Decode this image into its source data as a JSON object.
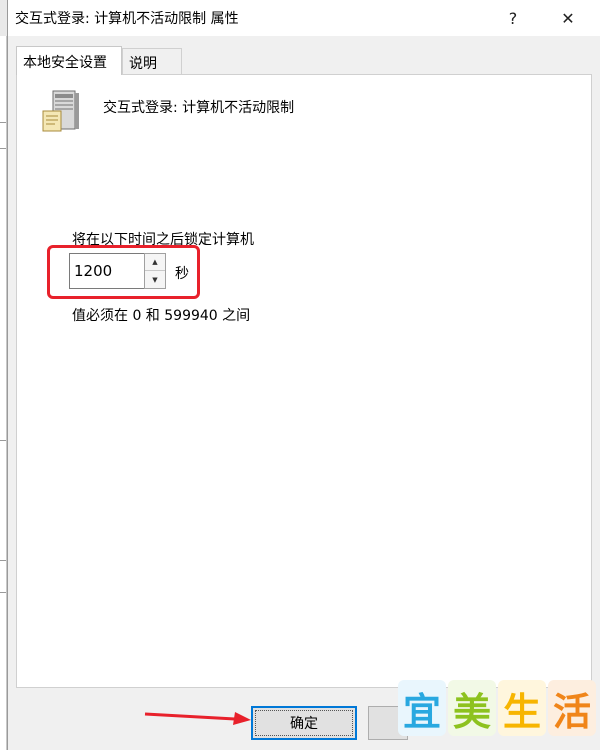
{
  "window": {
    "title": "交互式登录: 计算机不活动限制 属性",
    "help_label": "?",
    "close_label": "✕"
  },
  "tabs": [
    {
      "label": "本地安全设置",
      "active": true
    },
    {
      "label": "说明",
      "active": false
    }
  ],
  "policy": {
    "icon": "server-policy-icon",
    "name": "交互式登录: 计算机不活动限制"
  },
  "lock_setting": {
    "label": "将在以下时间之后锁定计算机",
    "value": "1200",
    "unit": "秒",
    "range_note": "值必须在 0 和 599940 之间"
  },
  "buttons": {
    "ok_label": "确定",
    "cancel_label": ""
  },
  "watermark": {
    "chars": [
      "宜",
      "美",
      "生",
      "活"
    ],
    "colors": [
      "#29a8e0",
      "#8dc21f",
      "#f7b500",
      "#f08519"
    ]
  },
  "annotation": {
    "highlight_color": "#e8212b",
    "arrow_color": "#e8212b"
  }
}
